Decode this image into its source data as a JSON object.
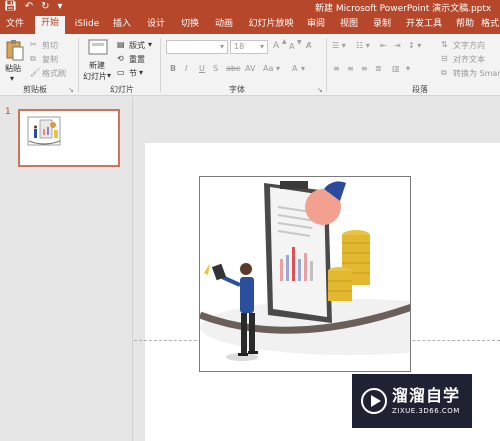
{
  "title_bar": {
    "document_title": "新建 Microsoft PowerPoint 演示文稿.pptx"
  },
  "tabs": [
    {
      "label": "文件",
      "active": false
    },
    {
      "label": "开始",
      "active": true
    },
    {
      "label": "iSlide",
      "active": false
    },
    {
      "label": "插入",
      "active": false
    },
    {
      "label": "设计",
      "active": false
    },
    {
      "label": "切换",
      "active": false
    },
    {
      "label": "动画",
      "active": false
    },
    {
      "label": "幻灯片放映",
      "active": false
    },
    {
      "label": "审阅",
      "active": false
    },
    {
      "label": "视图",
      "active": false
    },
    {
      "label": "录制",
      "active": false
    },
    {
      "label": "开发工具",
      "active": false
    },
    {
      "label": "帮助",
      "active": false
    },
    {
      "label": "格式",
      "active": false
    }
  ],
  "ribbon": {
    "clipboard": {
      "paste": "粘贴",
      "cut": "剪切",
      "copy": "复制",
      "format_painter": "格式刷",
      "group_label": "剪贴板"
    },
    "slides": {
      "new_slide_line1": "新建",
      "new_slide_line2": "幻灯片",
      "layout": "版式",
      "reset": "重置",
      "section": "节",
      "group_label": "幻灯片"
    },
    "font": {
      "size_value": "18",
      "bold": "B",
      "italic": "I",
      "underline": "U",
      "shadow": "S",
      "strikethrough": "abc",
      "spacing": "AV",
      "case": "Aa",
      "color": "A",
      "grow": "A",
      "shrink": "A",
      "group_label": "字体"
    },
    "paragraph": {
      "text_direction": "文字方向",
      "align_text": "对齐文本",
      "convert_smartart": "转换为 Smar",
      "group_label": "段落"
    }
  },
  "thumbnail_pane": {
    "slide_number": "1"
  },
  "watermark": {
    "name": "溜溜自学",
    "url": "ZIXUE.3D66.COM"
  },
  "colors": {
    "accent": "#b7472a",
    "selection": "#d0735a"
  }
}
